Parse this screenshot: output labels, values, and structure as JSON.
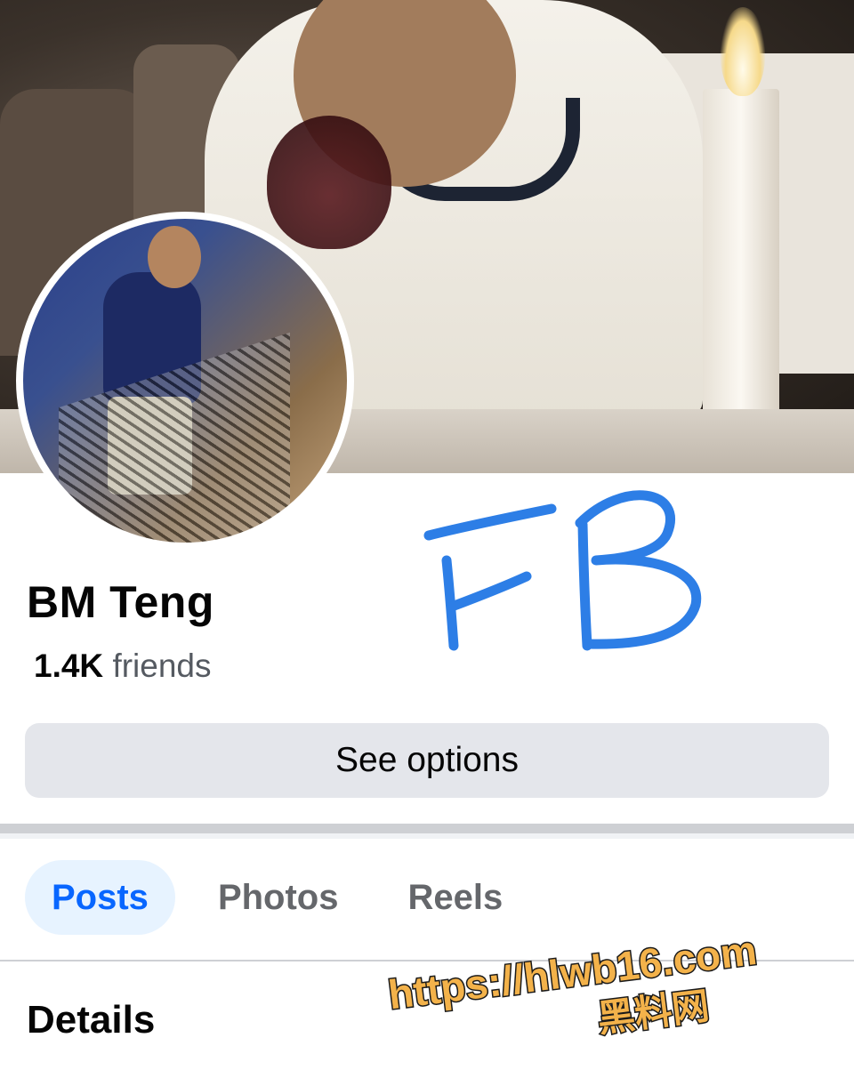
{
  "profile": {
    "name": "BM Teng",
    "friends_count": "1.4K",
    "friends_label": "friends",
    "handwriting": "FB"
  },
  "actions": {
    "see_options": "See options"
  },
  "tabs": [
    {
      "label": "Posts",
      "active": true
    },
    {
      "label": "Photos",
      "active": false
    },
    {
      "label": "Reels",
      "active": false
    }
  ],
  "sections": {
    "details": "Details"
  },
  "watermark": {
    "url": "https://hlwb16.com",
    "chinese": "黑料网"
  },
  "colors": {
    "accent": "#0866ff",
    "active_tab_bg": "#e7f3ff",
    "button_bg": "#e4e6eb",
    "handwriting": "#2d7ee6",
    "watermark_fill": "#f3b24a",
    "watermark_stroke": "#1a1a1a"
  }
}
